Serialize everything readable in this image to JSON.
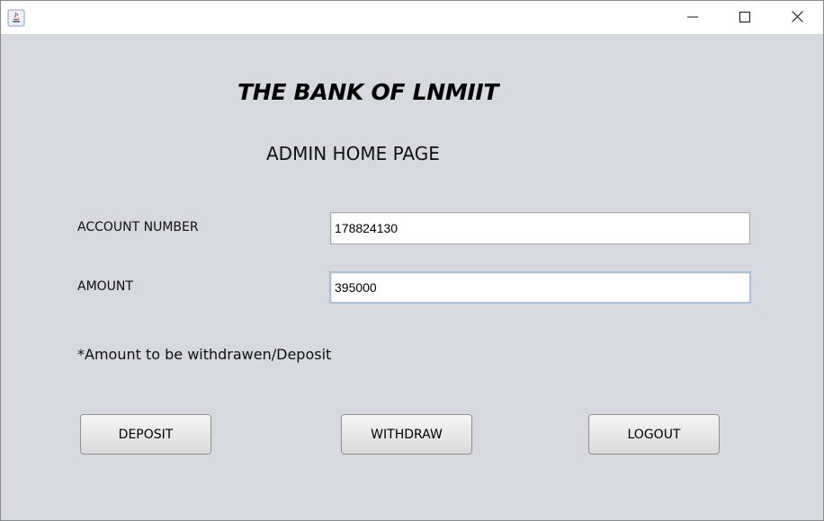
{
  "window": {
    "icon": "java-app-icon",
    "controls": {
      "minimize_icon": "minimize-icon",
      "maximize_icon": "maximize-icon",
      "close_icon": "close-icon"
    }
  },
  "header": {
    "bank_title": "THE BANK OF LNMIIT",
    "page_title": "ADMIN HOME PAGE"
  },
  "form": {
    "account_label": "ACCOUNT NUMBER",
    "account_value": "178824130",
    "amount_label": "AMOUNT",
    "amount_value": "395000",
    "note": "*Amount to be withdrawen/Deposit"
  },
  "actions": {
    "deposit_label": "DEPOSIT",
    "withdraw_label": "WITHDRAW",
    "logout_label": "LOGOUT"
  },
  "colors": {
    "background": "#d6d9e0",
    "titlebar": "#ffffff",
    "focus_border": "#a8c0dc"
  }
}
